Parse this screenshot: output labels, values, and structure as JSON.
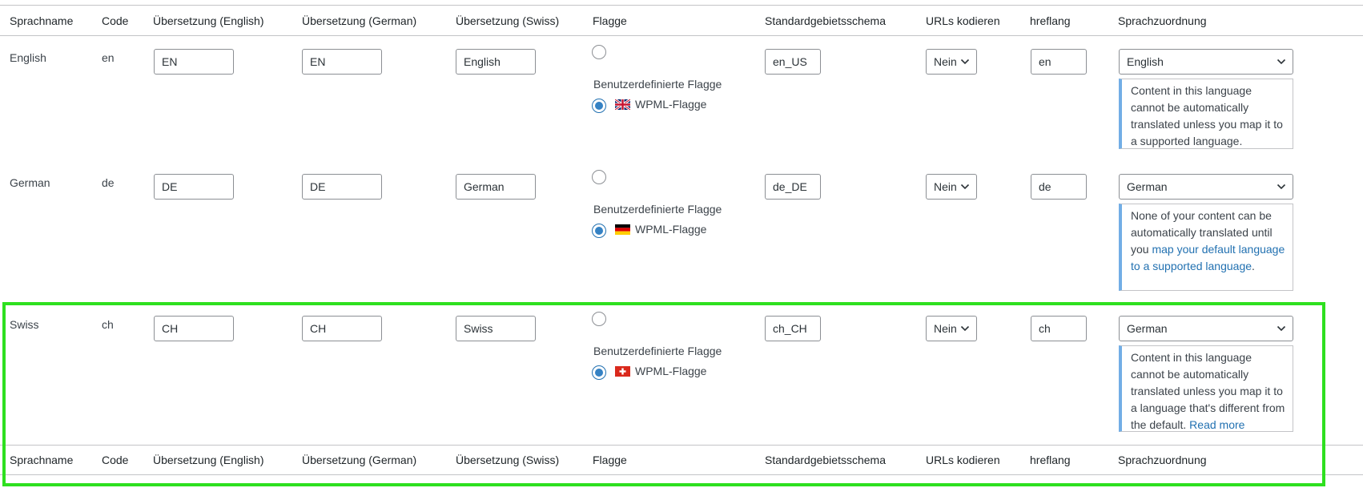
{
  "headers": [
    "Sprachname",
    "Code",
    "Übersetzung (English)",
    "Übersetzung (German)",
    "Übersetzung (Swiss)",
    "Flagge",
    "Standardgebietsschema",
    "URLs kodieren",
    "hreflang",
    "Sprachzuordnung"
  ],
  "rows": [
    {
      "name": "English",
      "code": "en",
      "tr_en": "EN",
      "tr_de": "EN",
      "tr_swiss": "English",
      "custom_flag_label": "Benutzerdefinierte Flagge",
      "wpml_flag_label": "WPML-Flagge",
      "locale": "en_US",
      "encode_urls": "Nein",
      "hreflang": "en",
      "mapping": "English",
      "notice": {
        "text": "Content in this language cannot be automatically translated unless you map it to a supported language.",
        "link": "",
        "suffix": ""
      }
    },
    {
      "name": "German",
      "code": "de",
      "tr_en": "DE",
      "tr_de": "DE",
      "tr_swiss": "German",
      "custom_flag_label": "Benutzerdefinierte Flagge",
      "wpml_flag_label": "WPML-Flagge",
      "locale": "de_DE",
      "encode_urls": "Nein",
      "hreflang": "de",
      "mapping": "German",
      "notice": {
        "text": "None of your content can be automatically translated until you ",
        "link": "map your default language to a supported language",
        "suffix": "."
      }
    },
    {
      "name": "Swiss",
      "code": "ch",
      "tr_en": "CH",
      "tr_de": "CH",
      "tr_swiss": "Swiss",
      "custom_flag_label": "Benutzerdefinierte Flagge",
      "wpml_flag_label": "WPML-Flagge",
      "locale": "ch_CH",
      "encode_urls": "Nein",
      "hreflang": "ch",
      "mapping": "German",
      "notice": {
        "text": "Content in this language cannot be automatically translated unless you map it to a language that's different from the default. ",
        "link": "Read more",
        "suffix": ""
      }
    }
  ],
  "colors": {
    "highlight": "#2ee01f",
    "notice_border": "#72aee6",
    "link": "#2271b1",
    "radio_checked": "#3582c4"
  },
  "icons": {
    "en": "uk-flag-icon",
    "de": "germany-flag-icon",
    "ch": "switzerland-flag-icon",
    "select": "chevron-down-icon"
  }
}
